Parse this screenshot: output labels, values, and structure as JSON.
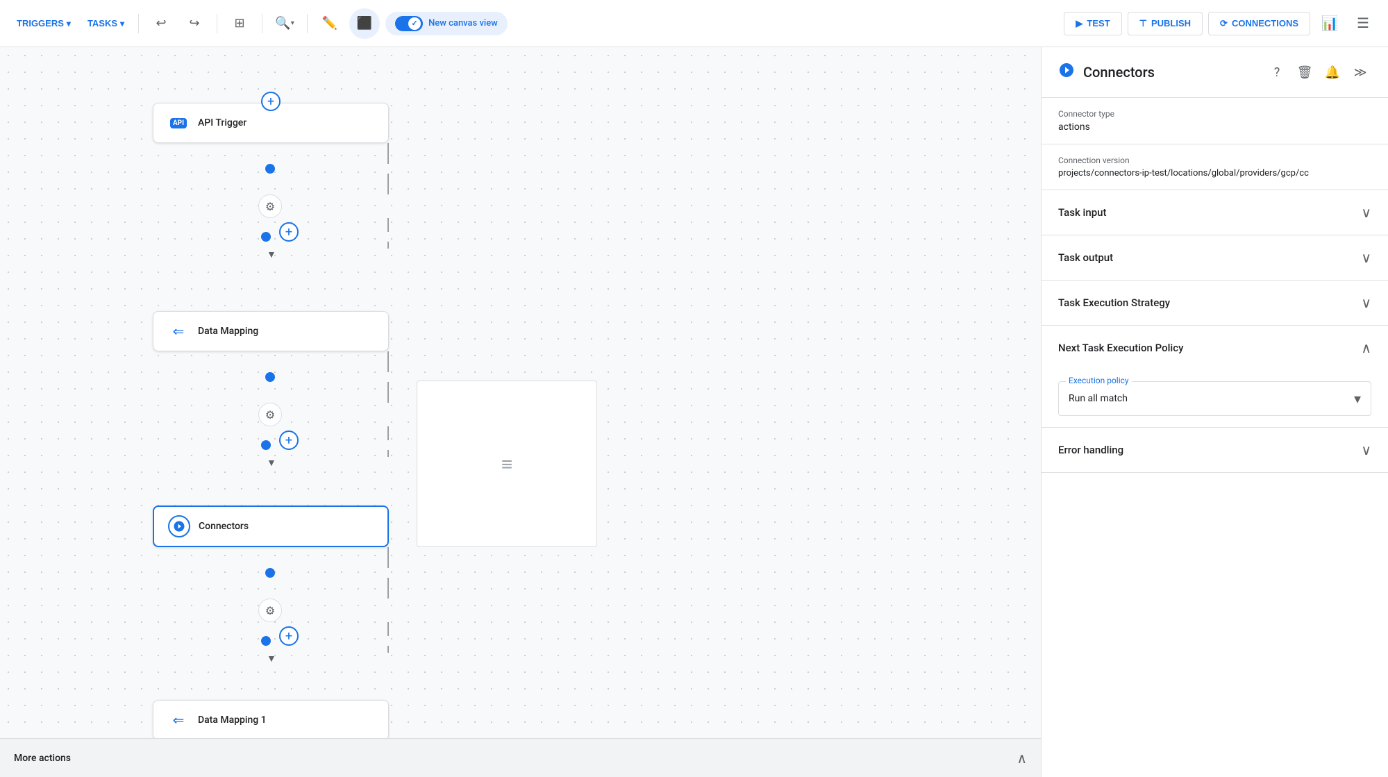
{
  "toolbar": {
    "triggers_label": "TRIGGERS",
    "tasks_label": "TASKS",
    "undo_icon": "↩",
    "redo_icon": "↪",
    "canvas_view_label": "New canvas view",
    "test_label": "TEST",
    "publish_label": "PUBLISH",
    "connections_label": "CONNECTIONS"
  },
  "workflow": {
    "api_trigger_label": "API Trigger",
    "api_icon_label": "API",
    "data_mapping_label": "Data Mapping",
    "connectors_label": "Connectors",
    "data_mapping_1_label": "Data Mapping 1"
  },
  "right_panel": {
    "title": "Connectors",
    "connector_type_label": "Connector type",
    "connector_type_value": "actions",
    "connection_version_label": "Connection version",
    "connection_version_value": "projects/connectors-ip-test/locations/global/providers/gcp/cc",
    "task_input_label": "Task input",
    "task_output_label": "Task output",
    "task_execution_strategy_label": "Task Execution Strategy",
    "next_task_execution_policy_label": "Next Task Execution Policy",
    "execution_policy_field_label": "Execution policy",
    "execution_policy_value": "Run all match",
    "error_handling_label": "Error handling"
  },
  "bottom_bar": {
    "more_actions_label": "More actions"
  }
}
